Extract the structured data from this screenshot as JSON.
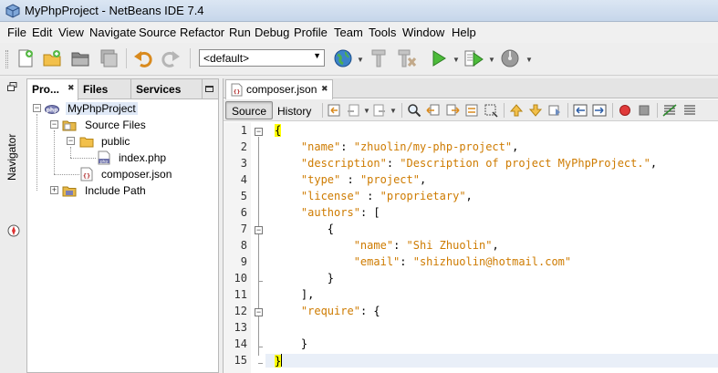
{
  "window": {
    "title": "MyPhpProject - NetBeans IDE 7.4"
  },
  "menu": [
    "File",
    "Edit",
    "View",
    "Navigate",
    "Source",
    "Refactor",
    "Run",
    "Debug",
    "Profile",
    "Team",
    "Tools",
    "Window",
    "Help"
  ],
  "toolbar": {
    "config_value": "<default>"
  },
  "navigator": {
    "label": "Navigator"
  },
  "projects_panel": {
    "tabs": [
      "Pro...",
      "Files",
      "Services"
    ],
    "tree": [
      {
        "label": "MyPhpProject"
      },
      {
        "label": "Source Files"
      },
      {
        "label": "public"
      },
      {
        "label": "index.php"
      },
      {
        "label": "composer.json"
      },
      {
        "label": "Include Path"
      }
    ]
  },
  "editor": {
    "tab_label": "composer.json",
    "views": [
      "Source",
      "History"
    ],
    "line_numbers": [
      "1",
      "2",
      "3",
      "4",
      "5",
      "6",
      "7",
      "8",
      "9",
      "10",
      "11",
      "12",
      "13",
      "14",
      "15"
    ],
    "lines": [
      {
        "indent": "",
        "segs": [
          {
            "t": "{",
            "c": "hl"
          }
        ]
      },
      {
        "indent": "    ",
        "segs": [
          {
            "t": "\"name\"",
            "c": "key"
          },
          {
            "t": ": ",
            "c": "punc"
          },
          {
            "t": "\"zhuolin/my-php-project\"",
            "c": "str"
          },
          {
            "t": ",",
            "c": "punc"
          }
        ]
      },
      {
        "indent": "    ",
        "segs": [
          {
            "t": "\"description\"",
            "c": "key"
          },
          {
            "t": ": ",
            "c": "punc"
          },
          {
            "t": "\"Description of project MyPhpProject.\"",
            "c": "str"
          },
          {
            "t": ",",
            "c": "punc"
          }
        ]
      },
      {
        "indent": "    ",
        "segs": [
          {
            "t": "\"type\"",
            "c": "key"
          },
          {
            "t": " : ",
            "c": "punc"
          },
          {
            "t": "\"project\"",
            "c": "str"
          },
          {
            "t": ",",
            "c": "punc"
          }
        ]
      },
      {
        "indent": "    ",
        "segs": [
          {
            "t": "\"license\"",
            "c": "key"
          },
          {
            "t": " : ",
            "c": "punc"
          },
          {
            "t": "\"proprietary\"",
            "c": "str"
          },
          {
            "t": ",",
            "c": "punc"
          }
        ]
      },
      {
        "indent": "    ",
        "segs": [
          {
            "t": "\"authors\"",
            "c": "key"
          },
          {
            "t": ": [",
            "c": "punc"
          }
        ]
      },
      {
        "indent": "        ",
        "segs": [
          {
            "t": "{",
            "c": "punc"
          }
        ]
      },
      {
        "indent": "            ",
        "segs": [
          {
            "t": "\"name\"",
            "c": "key"
          },
          {
            "t": ": ",
            "c": "punc"
          },
          {
            "t": "\"Shi Zhuolin\"",
            "c": "str"
          },
          {
            "t": ",",
            "c": "punc"
          }
        ]
      },
      {
        "indent": "            ",
        "segs": [
          {
            "t": "\"email\"",
            "c": "key"
          },
          {
            "t": ": ",
            "c": "punc"
          },
          {
            "t": "\"shizhuolin@hotmail.com\"",
            "c": "str"
          }
        ]
      },
      {
        "indent": "        ",
        "segs": [
          {
            "t": "}",
            "c": "punc"
          }
        ]
      },
      {
        "indent": "    ",
        "segs": [
          {
            "t": "],",
            "c": "punc"
          }
        ]
      },
      {
        "indent": "    ",
        "segs": [
          {
            "t": "\"require\"",
            "c": "key"
          },
          {
            "t": ": {",
            "c": "punc"
          }
        ]
      },
      {
        "indent": "",
        "segs": []
      },
      {
        "indent": "    ",
        "segs": [
          {
            "t": "}",
            "c": "punc"
          }
        ]
      },
      {
        "indent": "",
        "segs": [
          {
            "t": "}",
            "c": "hl"
          }
        ],
        "caret": true
      }
    ]
  },
  "colors": {
    "key": "#ce7b00",
    "string": "#ce7b00",
    "highlight": "#ffff00"
  }
}
